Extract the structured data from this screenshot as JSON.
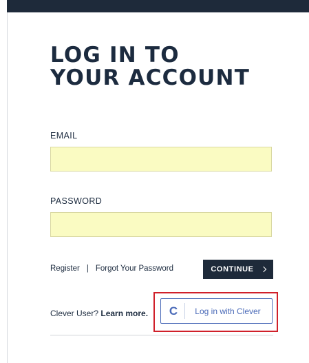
{
  "header": {
    "title_line1": "LOG IN TO",
    "title_line2": "YOUR ACCOUNT"
  },
  "form": {
    "email_label": "EMAIL",
    "email_value": "",
    "email_placeholder": "",
    "password_label": "PASSWORD",
    "password_value": "",
    "password_placeholder": ""
  },
  "links": {
    "register": "Register",
    "separator": "|",
    "forgot_password": "Forgot Your Password"
  },
  "continue_button": {
    "label": "CONTINUE",
    "icon": "chevron-right-icon"
  },
  "clever": {
    "prompt": "Clever User?",
    "learn_more": "Learn more.",
    "button_label": "Log in with Clever",
    "logo_letter": "C",
    "logo_icon": "clever-logo-icon"
  },
  "colors": {
    "navy": "#1e2a3a",
    "input_fill": "#fafbc2",
    "clever_blue": "#4a6ab8",
    "highlight_red": "#d0202a"
  }
}
